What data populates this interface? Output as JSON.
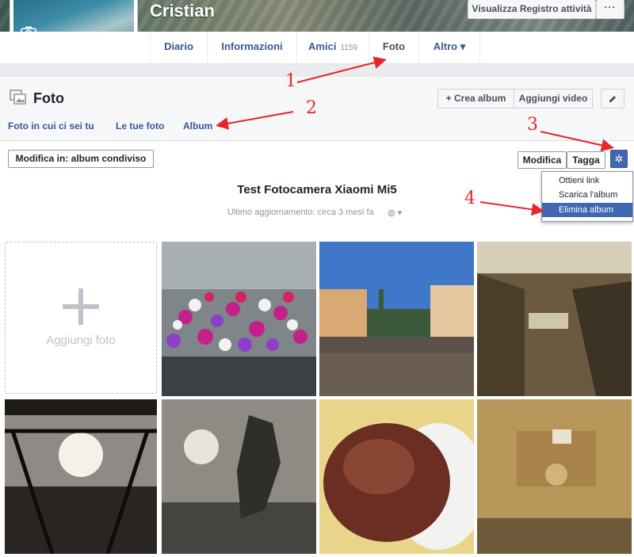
{
  "profile": {
    "name": "Cristian",
    "activity_log": "Visualizza Registro attività",
    "more": "···"
  },
  "nav": {
    "items": [
      {
        "label": "Diario"
      },
      {
        "label": "Informazioni"
      },
      {
        "label": "Amici",
        "count": "1159"
      },
      {
        "label": "Foto",
        "active": true
      },
      {
        "label": "Altro ▾"
      }
    ]
  },
  "photos": {
    "title": "Foto",
    "create_album": "+ Crea album",
    "add_video": "Aggiungi video",
    "tabs": [
      "Foto in cui ci sei tu",
      "Le tue foto",
      "Album"
    ],
    "edit_in": "Modifica in: album condiviso",
    "edit": "Modifica",
    "tag": "Tagga",
    "album_title": "Test Fotocamera Xiaomi Mi5",
    "album_updated": "Ultimo aggiornamento: circa 3 mesi fa",
    "add_photo": "Aggiungi foto"
  },
  "menu": {
    "items": [
      "Ottieni link",
      "Scarica l'album",
      "Elimina album"
    ],
    "selected": "Elimina album"
  },
  "annotations": [
    "1",
    "2",
    "3",
    "4"
  ],
  "colors": {
    "accent": "#4267b2",
    "link": "#365899",
    "annotation": "#e8262a"
  },
  "icons": [
    "camera-icon",
    "photos-icon",
    "pencil-icon",
    "gear-icon",
    "globe-icon",
    "plus-icon"
  ]
}
